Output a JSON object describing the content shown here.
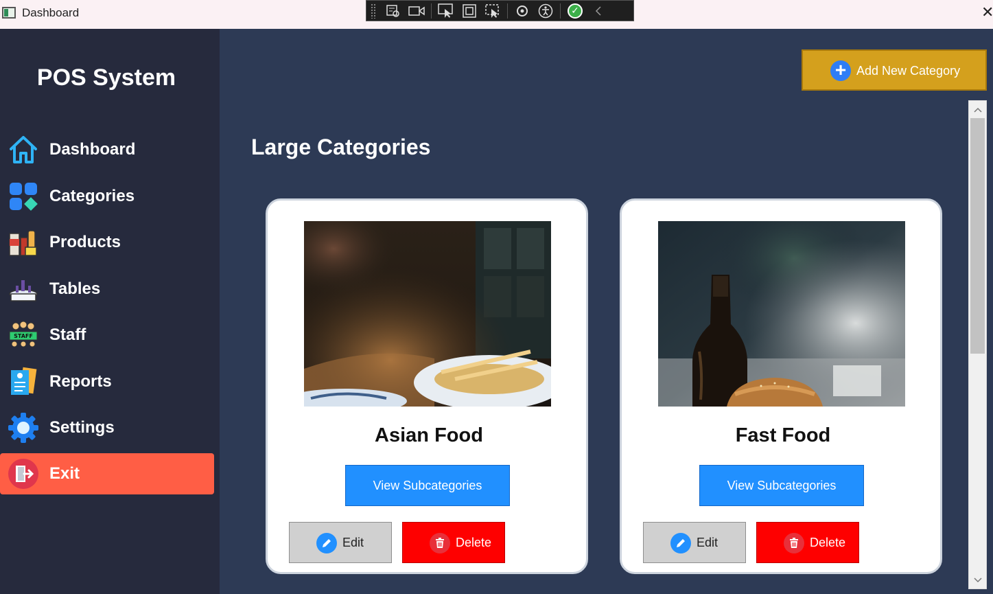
{
  "window": {
    "title": "Dashboard",
    "close_symbol": "✕"
  },
  "sidebar": {
    "brand": "POS System",
    "items": [
      {
        "label": "Dashboard",
        "icon": "home-icon"
      },
      {
        "label": "Categories",
        "icon": "categories-icon"
      },
      {
        "label": "Products",
        "icon": "products-icon"
      },
      {
        "label": "Tables",
        "icon": "tables-icon"
      },
      {
        "label": "Staff",
        "icon": "staff-icon"
      },
      {
        "label": "Reports",
        "icon": "reports-icon"
      },
      {
        "label": "Settings",
        "icon": "gear-icon"
      },
      {
        "label": "Exit",
        "icon": "exit-icon"
      }
    ]
  },
  "toolbar": {
    "add_label": "Add New Category"
  },
  "main": {
    "section_title": "Large Categories",
    "cards": [
      {
        "name": "Asian Food",
        "view_label": "View Subcategories",
        "edit_label": "Edit",
        "delete_label": "Delete"
      },
      {
        "name": "Fast Food",
        "view_label": "View Subcategories",
        "edit_label": "Edit",
        "delete_label": "Delete"
      }
    ]
  },
  "colors": {
    "sidebar_bg": "#262a3d",
    "main_bg": "#2d3a55",
    "accent_add": "#d4a01d",
    "view_button": "#2190ff",
    "delete_button": "#fe0000",
    "exit_highlight": "#ff5e45"
  }
}
